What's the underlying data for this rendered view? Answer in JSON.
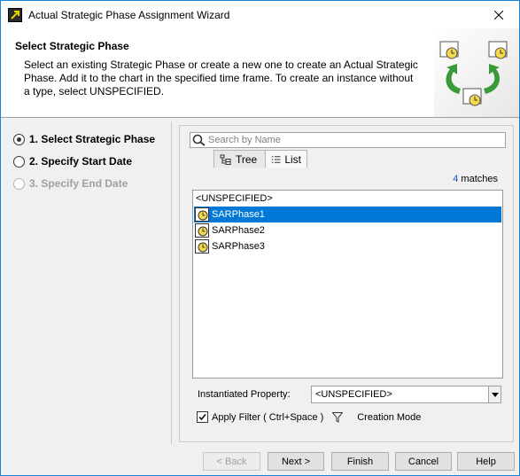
{
  "window": {
    "title": "Actual Strategic Phase Assignment Wizard"
  },
  "header": {
    "title": "Select Strategic Phase",
    "description": "Select an existing Strategic Phase or create a new one to create an Actual Strategic Phase. Add it to the chart in the specified time frame. To create an instance without a type, select UNSPECIFIED."
  },
  "steps": [
    {
      "label": "1. Select Strategic Phase",
      "state": "current"
    },
    {
      "label": "2. Specify Start Date",
      "state": "enabled"
    },
    {
      "label": "3. Specify End Date",
      "state": "disabled"
    }
  ],
  "search": {
    "placeholder": "Search by Name",
    "value": ""
  },
  "tabs": [
    {
      "label": "Tree",
      "icon": "tree-icon",
      "active": false
    },
    {
      "label": "List",
      "icon": "list-icon",
      "active": true
    }
  ],
  "matches": {
    "count": "4",
    "suffix": "matches"
  },
  "list": {
    "items": [
      {
        "label": "<UNSPECIFIED>",
        "icon": "",
        "selected": false
      },
      {
        "label": "SARPhase1",
        "icon": "phase-clock-icon",
        "selected": true
      },
      {
        "label": "SARPhase2",
        "icon": "phase-clock-icon",
        "selected": false
      },
      {
        "label": "SARPhase3",
        "icon": "phase-clock-icon",
        "selected": false
      }
    ]
  },
  "property": {
    "label": "Instantiated Property:",
    "value": "<UNSPECIFIED>"
  },
  "filter": {
    "label": "Apply Filter ( Ctrl+Space )",
    "checked": true,
    "mode_label": "Creation Mode"
  },
  "buttons": {
    "back": "< Back",
    "next": "Next >",
    "finish": "Finish",
    "cancel": "Cancel",
    "help": "Help"
  },
  "colors": {
    "accent": "#0078d7",
    "match_count": "#2050c0",
    "arrow_green": "#3a9a3a"
  }
}
